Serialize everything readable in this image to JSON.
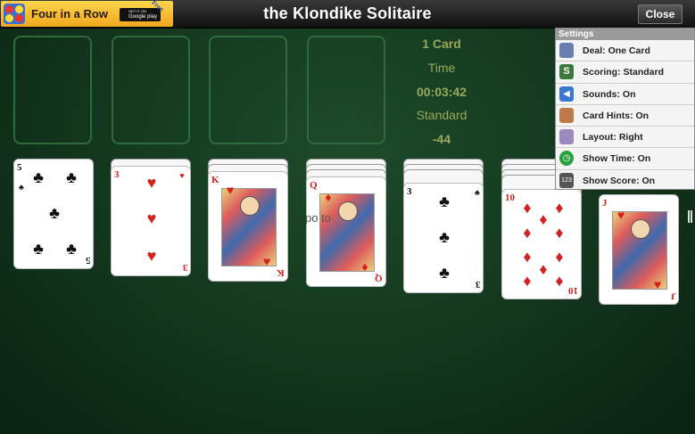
{
  "ad": {
    "title": "Four in a Row",
    "store_top": "GET IT ON",
    "store": "Google play",
    "badge": "Free"
  },
  "header": {
    "title": "the Klondike Solitaire",
    "close_label": "Close"
  },
  "info": {
    "deal": "1 Card",
    "time_label": "Time",
    "time": "00:03:42",
    "scoring": "Standard",
    "score": "-44"
  },
  "ghost_text": "po      to",
  "tableau": [
    {
      "rank": "5",
      "suit": "♣",
      "color": "blk"
    },
    {
      "rank": "3",
      "suit": "♥",
      "color": "red"
    },
    {
      "rank": "K",
      "suit": "♥",
      "color": "red"
    },
    {
      "rank": "Q",
      "suit": "♦",
      "color": "red"
    },
    {
      "rank": "3",
      "suit": "♣",
      "color": "blk"
    },
    {
      "rank": "10",
      "suit": "♦",
      "color": "red"
    },
    {
      "rank": "J",
      "suit": "♥",
      "color": "red"
    }
  ],
  "settings": {
    "title": "Settings",
    "items": [
      {
        "label": "Deal: One Card",
        "icon": "card-icon",
        "color": "#6a7fb0"
      },
      {
        "label": "Scoring: Standard",
        "icon": "scoring-icon",
        "color": "#3a7a3a"
      },
      {
        "label": "Sounds: On",
        "icon": "speaker-icon",
        "color": "#3a78d0"
      },
      {
        "label": "Card Hints: On",
        "icon": "hint-card-icon",
        "color": "#c07a4a"
      },
      {
        "label": "Layout: Right",
        "icon": "hand-icon",
        "color": "#9a8ac0"
      },
      {
        "label": "Show Time: On",
        "icon": "clock-icon",
        "color": "#2aa040"
      },
      {
        "label": "Show Score: On",
        "icon": "score-icon",
        "color": "#555555"
      }
    ]
  }
}
